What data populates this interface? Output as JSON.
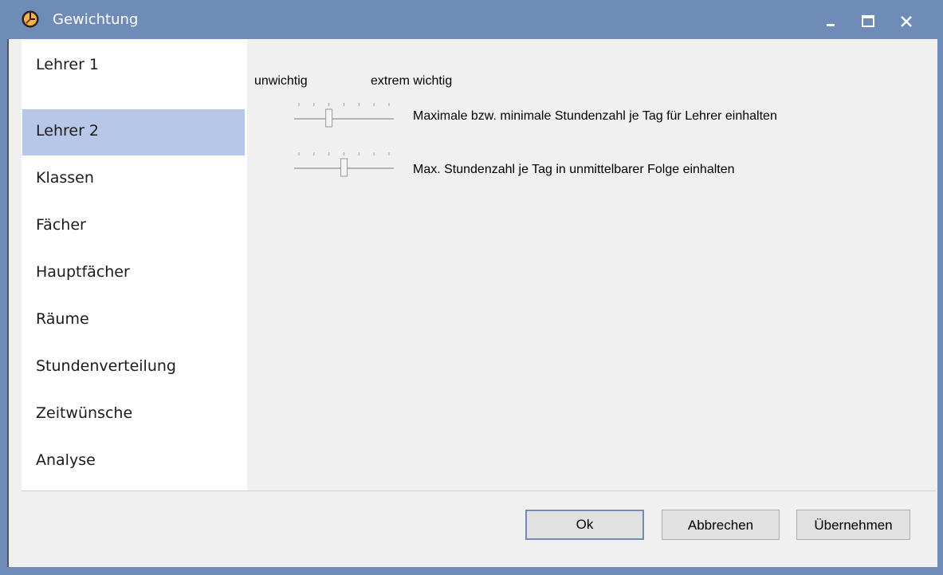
{
  "window": {
    "title": "Gewichtung",
    "app_icon": "clock-icon",
    "controls": [
      "minimize-icon",
      "maximize-icon",
      "close-icon"
    ]
  },
  "sidebar": {
    "items": [
      {
        "label": "Lehrer 1",
        "active": false
      },
      {
        "label": "Lehrer 2",
        "active": true
      },
      {
        "label": "Klassen",
        "active": false
      },
      {
        "label": "Fächer",
        "active": false
      },
      {
        "label": "Hauptfächer",
        "active": false
      },
      {
        "label": "Räume",
        "active": false
      },
      {
        "label": "Stundenverteilung",
        "active": false
      },
      {
        "label": "Zeitwünsche",
        "active": false
      },
      {
        "label": "Analyse",
        "active": false
      }
    ]
  },
  "main": {
    "scale_low": "unwichtig",
    "scale_high": "extrem wichtig",
    "settings": [
      {
        "label": "Maximale bzw. minimale Stundenzahl je Tag für Lehrer einhalten",
        "level": 2,
        "max": 6
      },
      {
        "label": "Max. Stundenzahl je Tag in unmittelbarer Folge einhalten",
        "level": 3,
        "max": 6
      }
    ]
  },
  "footer": {
    "ok_label": "Ok",
    "cancel_label": "Abbrechen",
    "apply_label": "Übernehmen"
  },
  "colors": {
    "titlebar": "#6f8bb8",
    "selection": "#b6c7e7",
    "panel": "#f0f0f0"
  }
}
